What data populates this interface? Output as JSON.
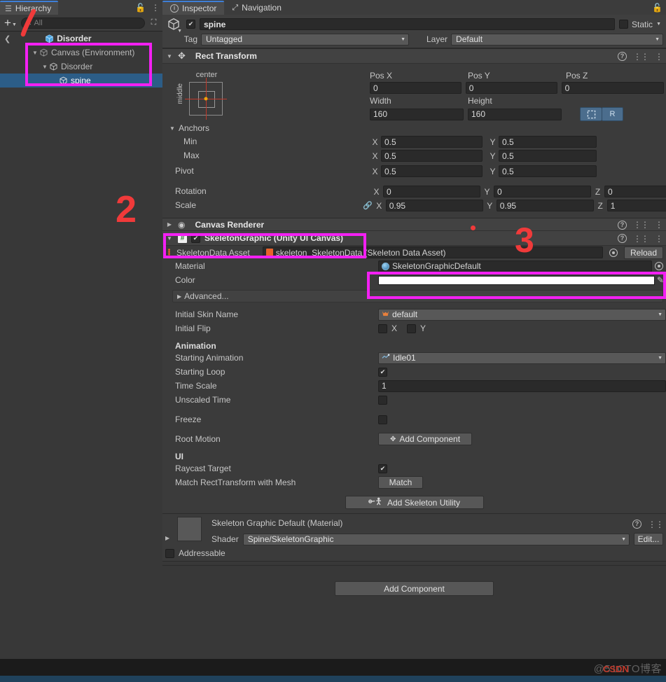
{
  "hierarchy": {
    "tab_label": "Hierarchy",
    "tab_icon": "hierarchy-list-icon",
    "add_label": "+",
    "search_placeholder": "All",
    "scene_name": "Disorder",
    "items": [
      {
        "label": "Canvas (Environment)",
        "indent": 0,
        "expanded": true,
        "selected": false
      },
      {
        "label": "Disorder",
        "indent": 1,
        "expanded": true,
        "selected": false
      },
      {
        "label": "spine",
        "indent": 2,
        "expanded": false,
        "selected": true
      }
    ]
  },
  "inspector": {
    "tabs": [
      {
        "label": "Inspector",
        "icon": "info-icon",
        "active": true
      },
      {
        "label": "Navigation",
        "icon": "navigation-icon",
        "active": false
      }
    ],
    "object_name": "spine",
    "enabled": true,
    "static_label": "Static",
    "static_checked": false,
    "tag_label": "Tag",
    "tag_value": "Untagged",
    "layer_label": "Layer",
    "layer_value": "Default"
  },
  "rect_transform": {
    "title": "Rect Transform",
    "anchor_preset_top": "center",
    "anchor_preset_left": "middle",
    "pos_x_label": "Pos X",
    "pos_y_label": "Pos Y",
    "pos_z_label": "Pos Z",
    "pos_x": "0",
    "pos_y": "0",
    "pos_z": "0",
    "width_label": "Width",
    "height_label": "Height",
    "width": "160",
    "height": "160",
    "blue_btn_1": "",
    "blue_btn_2": "R",
    "anchors_label": "Anchors",
    "min_label": "Min",
    "max_label": "Max",
    "pivot_label": "Pivot",
    "min_x": "0.5",
    "min_y": "0.5",
    "max_x": "0.5",
    "max_y": "0.5",
    "pivot_x": "0.5",
    "pivot_y": "0.5",
    "rotation_label": "Rotation",
    "rot_x": "0",
    "rot_y": "0",
    "rot_z": "0",
    "scale_label": "Scale",
    "scale_x": "0.95",
    "scale_y": "0.95",
    "scale_z": "1",
    "axis_x": "X",
    "axis_y": "Y",
    "axis_z": "Z"
  },
  "canvas_renderer": {
    "title": "Canvas Renderer"
  },
  "skeleton_graphic": {
    "title": "SkeletonGraphic (Unity UI Canvas)",
    "enabled": true,
    "icon": "script-hash-icon",
    "skeleton_data_label": "SkeletonData Asset",
    "skeleton_data_value": "skeleton_SkeletonData (Skeleton Data Asset)",
    "reload_label": "Reload",
    "material_label": "Material",
    "material_value": "SkeletonGraphicDefault",
    "color_label": "Color",
    "color_value": "#FFFFFF",
    "advanced_label": "Advanced...",
    "initial_skin_label": "Initial Skin Name",
    "initial_skin_value": "default",
    "initial_flip_label": "Initial Flip",
    "flip_x_label": "X",
    "flip_y_label": "Y",
    "flip_x": false,
    "flip_y": false,
    "animation_section": "Animation",
    "starting_animation_label": "Starting Animation",
    "starting_animation_value": "Idle01",
    "starting_loop_label": "Starting Loop",
    "starting_loop": true,
    "time_scale_label": "Time Scale",
    "time_scale_value": "1",
    "unscaled_time_label": "Unscaled Time",
    "unscaled_time": false,
    "freeze_label": "Freeze",
    "freeze": false,
    "root_motion_label": "Root Motion",
    "root_motion_button": "Add Component",
    "ui_section": "UI",
    "raycast_target_label": "Raycast Target",
    "raycast_target": true,
    "match_rect_label": "Match RectTransform with Mesh",
    "match_button": "Match",
    "add_skeleton_utility_label": "Add Skeleton Utility"
  },
  "material_block": {
    "title": "Skeleton Graphic Default (Material)",
    "shader_label": "Shader",
    "shader_value": "Spine/SkeletonGraphic",
    "edit_label": "Edit...",
    "addressable_label": "Addressable",
    "addressable": false
  },
  "add_component": {
    "label": "Add Component"
  },
  "annotations": {
    "mark_1": "1",
    "mark_2": "2",
    "mark_3": "3",
    "highlight_color": "#F320F3",
    "mark_color": "#F03A3A"
  },
  "watermark": {
    "text": "@51CTO博客",
    "brand": "CSDN"
  }
}
